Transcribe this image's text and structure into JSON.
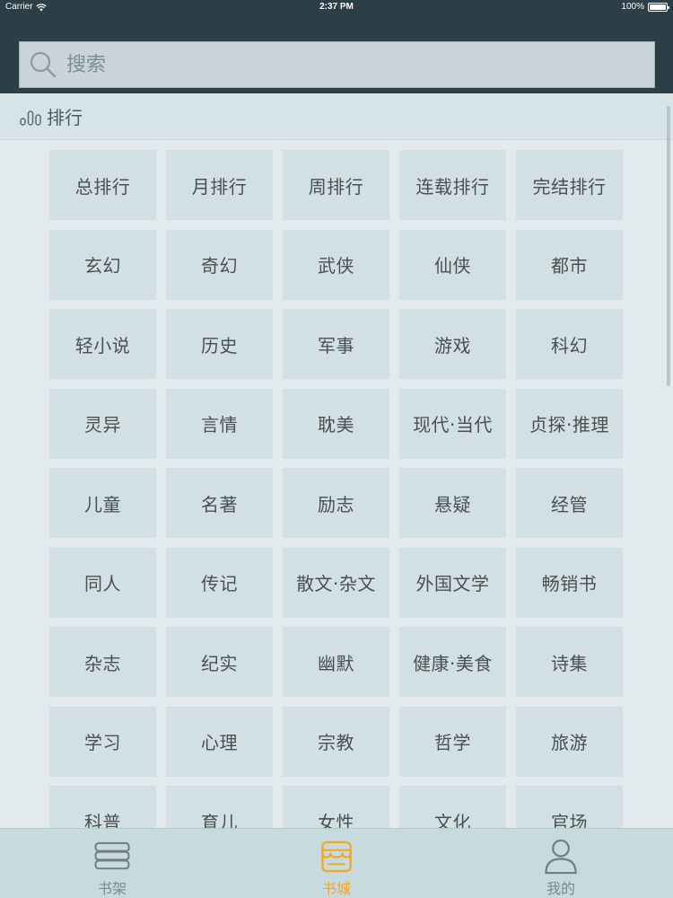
{
  "status_bar": {
    "carrier": "Carrier",
    "time": "2:37 PM",
    "battery": "100%"
  },
  "search": {
    "placeholder": "搜索"
  },
  "section": {
    "title": "排行",
    "icon": "bar-chart-icon"
  },
  "categories": [
    "总排行",
    "月排行",
    "周排行",
    "连载排行",
    "完结排行",
    "玄幻",
    "奇幻",
    "武侠",
    "仙侠",
    "都市",
    "轻小说",
    "历史",
    "军事",
    "游戏",
    "科幻",
    "灵异",
    "言情",
    "耽美",
    "现代·当代",
    "贞探·推理",
    "儿童",
    "名著",
    "励志",
    "悬疑",
    "经管",
    "同人",
    "传记",
    "散文·杂文",
    "外国文学",
    "畅销书",
    "杂志",
    "纪实",
    "幽默",
    "健康·美食",
    "诗集",
    "学习",
    "心理",
    "宗教",
    "哲学",
    "旅游",
    "科普",
    "育儿",
    "女性",
    "文化",
    "官场"
  ],
  "tabbar": {
    "tabs": [
      {
        "label": "书架",
        "icon": "bookshelf-icon",
        "active": false
      },
      {
        "label": "书城",
        "icon": "bookstore-icon",
        "active": true
      },
      {
        "label": "我的",
        "icon": "profile-icon",
        "active": false
      }
    ]
  },
  "colors": {
    "header": "#2c3e46",
    "accent": "#f5a623",
    "tile": "#d3e0e3"
  }
}
